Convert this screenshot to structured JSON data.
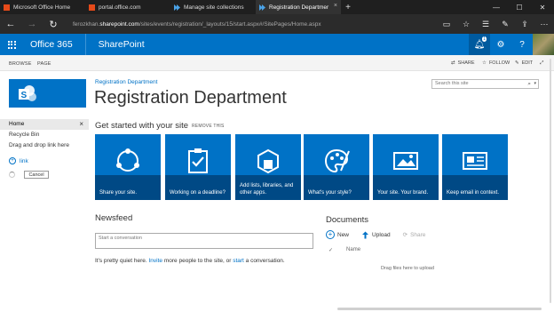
{
  "browser": {
    "tabs": [
      {
        "label": "Microsoft Office Home",
        "active": false
      },
      {
        "label": "portal.office.com",
        "active": false
      },
      {
        "label": "Manage site collections",
        "active": false
      },
      {
        "label": "Registration Departmer",
        "active": true
      }
    ],
    "new_tab_label": "+",
    "url_prefix": "ferozkhan.",
    "url_domain": "sharepoint.com",
    "url_path": "/sites/events/registration/_layouts/15/start.aspx#/SitePages/Home.aspx"
  },
  "suite": {
    "app_launcher_label": "Office 365",
    "product": "SharePoint",
    "notification_count": "1"
  },
  "ribbon": {
    "tabs": [
      "BROWSE",
      "PAGE"
    ],
    "actions": [
      {
        "icon": "share-icon",
        "label": "SHARE"
      },
      {
        "icon": "star-icon",
        "label": "FOLLOW"
      },
      {
        "icon": "edit-icon",
        "label": "EDIT"
      }
    ]
  },
  "leftnav": {
    "items": [
      "Home",
      "Recycle Bin",
      "Drag and drop link here"
    ],
    "link_label": "link",
    "cancel_label": "Cancel"
  },
  "site": {
    "breadcrumb": "Registration Department",
    "title": "Registration Department",
    "search_placeholder": "Search this site"
  },
  "getting_started": {
    "heading": "Get started with your site",
    "remove_label": "REMOVE THIS",
    "tiles": [
      {
        "icon": "share-site-icon",
        "caption": "Share your site."
      },
      {
        "icon": "clipboard-check-icon",
        "caption": "Working on a deadline?"
      },
      {
        "icon": "add-apps-icon",
        "caption": "Add lists, libraries, and other apps."
      },
      {
        "icon": "palette-icon",
        "caption": "What's your style?"
      },
      {
        "icon": "brand-image-icon",
        "caption": "Your site. Your brand."
      },
      {
        "icon": "email-icon",
        "caption": "Keep email in context."
      }
    ]
  },
  "newsfeed": {
    "heading": "Newsfeed",
    "placeholder": "Start a conversation",
    "quiet_prefix": "It's pretty quiet here. ",
    "invite_link": "Invite",
    "quiet_middle": " more people to the site, or ",
    "start_link": "start",
    "quiet_suffix": " a conversation."
  },
  "documents": {
    "heading": "Documents",
    "new_label": "New",
    "upload_label": "Upload",
    "share_label": "Share",
    "check_glyph": "✓",
    "name_column": "Name",
    "drag_hint": "Drag files here to upload"
  },
  "colors": {
    "suite_blue": "#0072c6",
    "tile_blue": "#0072c6",
    "browser_dark": "#1f1f1f"
  }
}
